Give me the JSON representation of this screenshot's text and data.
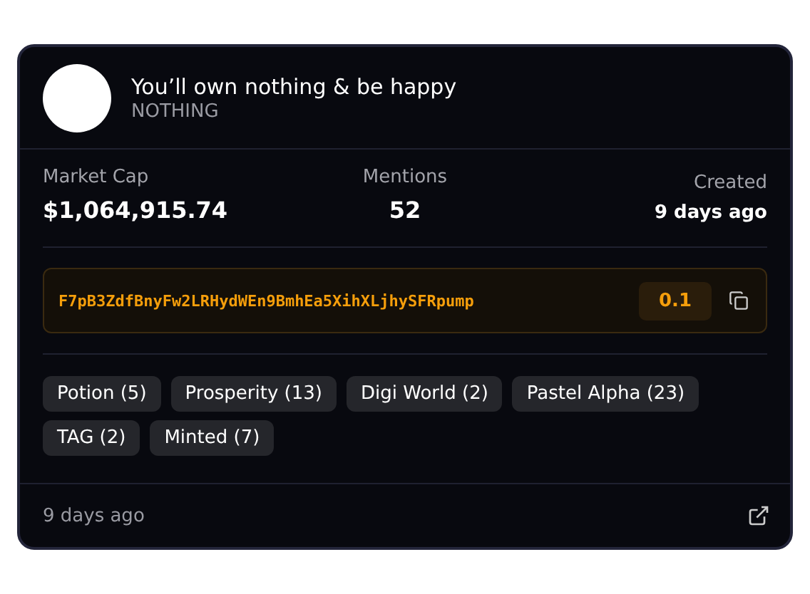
{
  "token": {
    "name": "You’ll own nothing & be happy",
    "symbol": "NOTHING"
  },
  "stats": [
    {
      "label": "Market Cap",
      "value": "$1,064,915.74"
    },
    {
      "label": "Mentions",
      "value": "52"
    },
    {
      "label": "Created",
      "value": "9 days ago"
    }
  ],
  "address": {
    "value": "F7pB3ZdfBnyFw2LRHydWEn9BmhEa5XihXLjhySFRpump",
    "badge": "0.1"
  },
  "tags": [
    "Potion (5)",
    "Prosperity (13)",
    "Digi World (2)",
    "Pastel Alpha (23)",
    "TAG (2)",
    "Minted (7)"
  ],
  "footer": {
    "time": "9 days ago"
  }
}
